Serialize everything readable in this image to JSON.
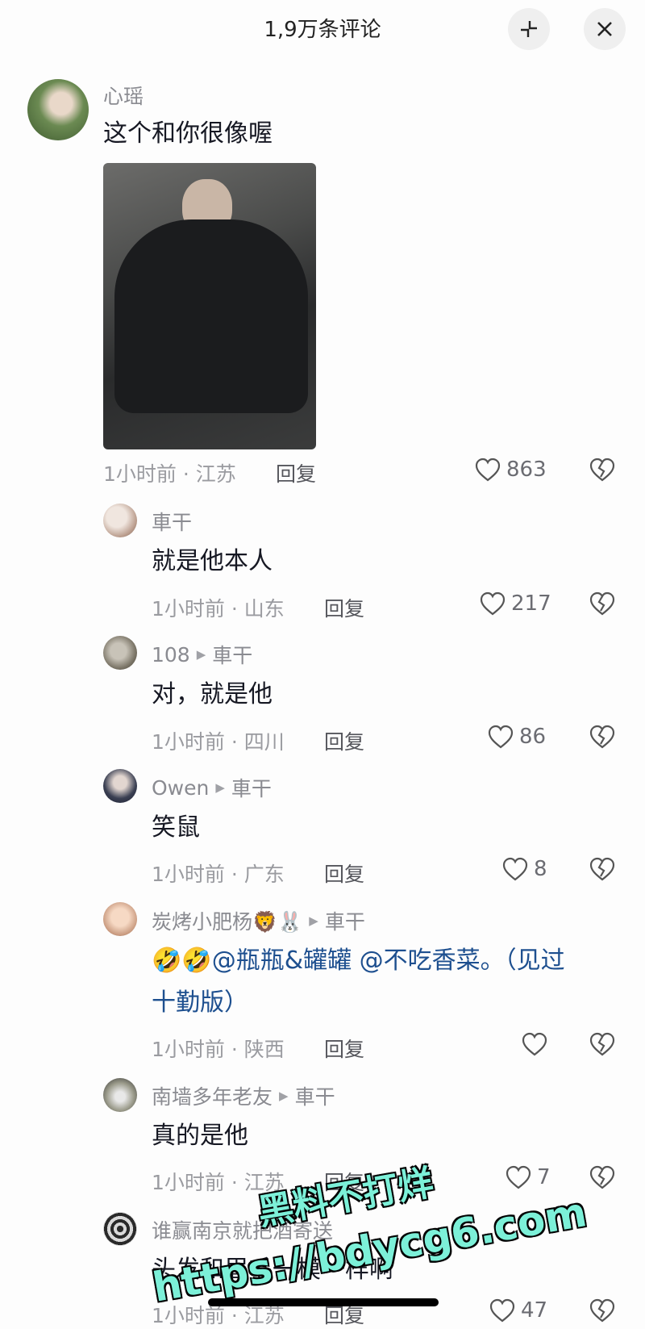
{
  "header": {
    "title": "1,9万条评论"
  },
  "comments": [
    {
      "name": "心瑶",
      "text": "这个和你很像喔",
      "time": "1小时前 · 江苏",
      "reply": "回复",
      "likes": "863"
    },
    {
      "name": "車干",
      "text": "就是他本人",
      "time": "1小时前 · 山东",
      "reply": "回复",
      "likes": "217"
    },
    {
      "name": "108",
      "reply_to": "車干",
      "text": "对，就是他",
      "time": "1小时前 · 四川",
      "reply": "回复",
      "likes": "86"
    },
    {
      "name": "Owen",
      "reply_to": "車干",
      "text": "笑鼠",
      "time": "1小时前 · 广东",
      "reply": "回复",
      "likes": "8"
    },
    {
      "name": "炭烤小肥杨🦁🐰",
      "reply_to": "車干",
      "emoji": "🤣🤣",
      "mention1": "@瓶瓶&罐罐",
      "mention2": "@不吃香菜。（见过",
      "mention3": "十勤版）",
      "time": "1小时前 · 陕西",
      "reply": "回复",
      "likes": ""
    },
    {
      "name": "南墙多年老友",
      "reply_to": "車干",
      "text": "真的是他",
      "time": "1小时前 · 江苏",
      "reply": "回复",
      "likes": "7"
    },
    {
      "name": "谁赢南京就把酒寄送",
      "text": "头发和眉毛一模一样啊",
      "time": "1小时前 · 江苏",
      "reply": "回复",
      "likes": "47"
    }
  ],
  "watermark": {
    "line1": "黑料不打烊",
    "line2": "https://bdycg6.com"
  },
  "colors": {
    "mention": "#1d4f8f",
    "watermark": "#7cf0d8"
  }
}
